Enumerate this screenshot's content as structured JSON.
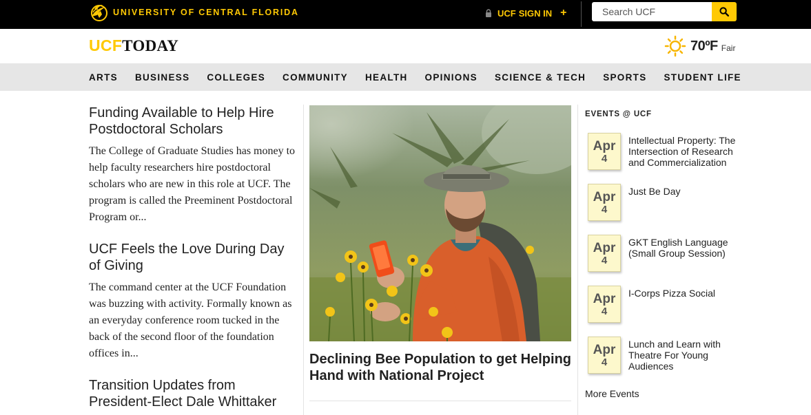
{
  "topbar": {
    "wordmark": "UNIVERSITY OF CENTRAL FLORIDA",
    "signin_prefix": "UCF",
    "signin_label": "SIGN IN",
    "plus_symbol": "+",
    "search_placeholder": "Search UCF",
    "accent_color": "#ffc904"
  },
  "header": {
    "brand_ucf": "UCF",
    "brand_today": "TODAY",
    "temperature": "70ºF",
    "condition": "Fair",
    "weather_icon": "sun-icon"
  },
  "nav": {
    "items": [
      {
        "label": "ARTS"
      },
      {
        "label": "BUSINESS"
      },
      {
        "label": "COLLEGES"
      },
      {
        "label": "COMMUNITY"
      },
      {
        "label": "HEALTH"
      },
      {
        "label": "OPINIONS"
      },
      {
        "label": "SCIENCE & TECH"
      },
      {
        "label": "SPORTS"
      },
      {
        "label": "STUDENT LIFE"
      }
    ]
  },
  "stories": [
    {
      "title": "Funding Available to Help Hire Postdoctoral Scholars",
      "excerpt": "The College of Graduate Studies has money to help faculty researchers hire postdoctoral scholars who are new in this role at UCF. The program is called the Preeminent Postdoctoral Program or..."
    },
    {
      "title": "UCF Feels the Love During Day of Giving",
      "excerpt": "The command center at the UCF Foundation was buzzing with activity. Formally known as an everyday conference room tucked in the back of the second floor of the foundation offices in..."
    },
    {
      "title": "Transition Updates from President-Elect Dale Whittaker",
      "excerpt": ""
    }
  ],
  "feature": {
    "title": "Declining Bee Population to get Helping Hand with National Project"
  },
  "events": {
    "heading": "EVENTS @ UCF",
    "items": [
      {
        "month": "Apr",
        "day": "4",
        "title": "Intellectual Property: The Intersection of Research and Commercialization"
      },
      {
        "month": "Apr",
        "day": "4",
        "title": "Just Be Day"
      },
      {
        "month": "Apr",
        "day": "4",
        "title": "GKT English Language (Small Group Session)"
      },
      {
        "month": "Apr",
        "day": "4",
        "title": "I-Corps Pizza Social"
      },
      {
        "month": "Apr",
        "day": "4",
        "title": "Lunch and Learn with Theatre For Young Audiences"
      }
    ],
    "more_label": "More Events"
  }
}
